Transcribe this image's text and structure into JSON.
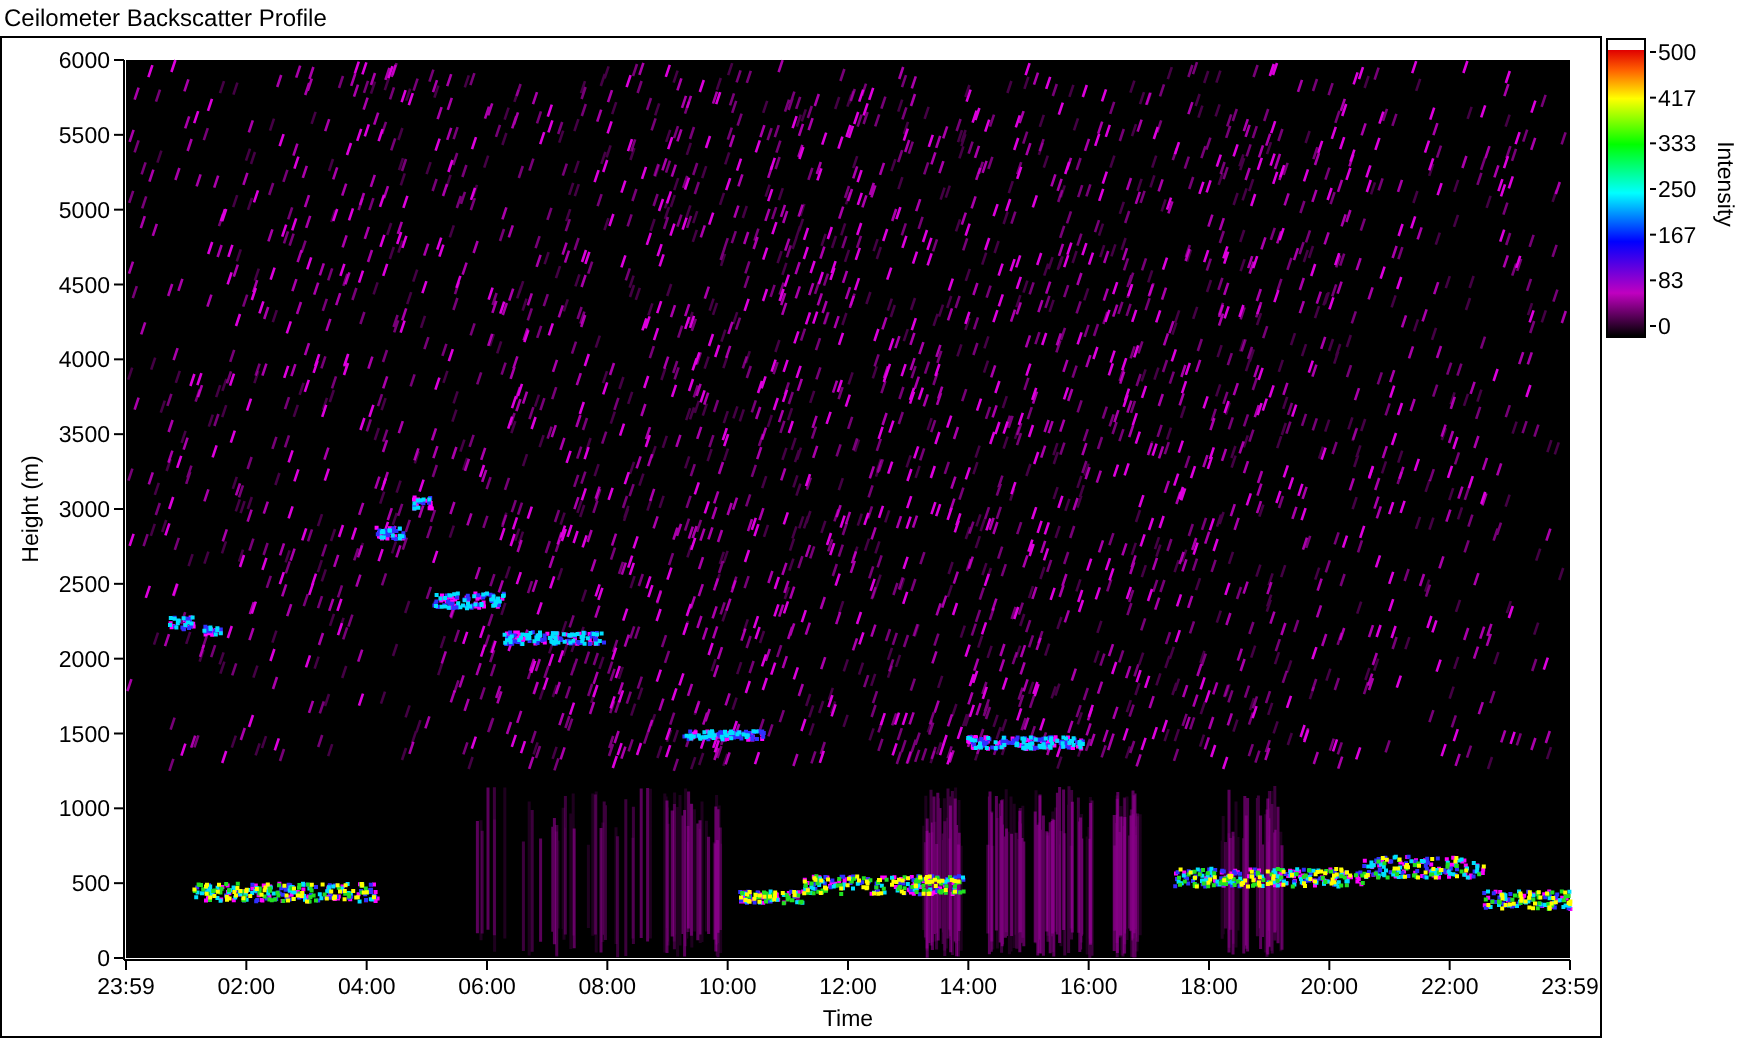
{
  "title": "Ceilometer Backscatter Profile",
  "plot": {
    "y_axis_label": "Height (m)",
    "x_axis_label": "Time",
    "y_ticks": [
      "6000",
      "5500",
      "5000",
      "4500",
      "4000",
      "3500",
      "3000",
      "2500",
      "2000",
      "1500",
      "1000",
      "500",
      "0"
    ],
    "x_ticks": [
      "23:59",
      "02:00",
      "04:00",
      "06:00",
      "08:00",
      "10:00",
      "12:00",
      "14:00",
      "16:00",
      "18:00",
      "20:00",
      "22:00",
      "23:59"
    ]
  },
  "colorbar": {
    "label": "Intensity",
    "ticks": [
      "500",
      "417",
      "333",
      "250",
      "167",
      "83",
      "0"
    ]
  }
}
